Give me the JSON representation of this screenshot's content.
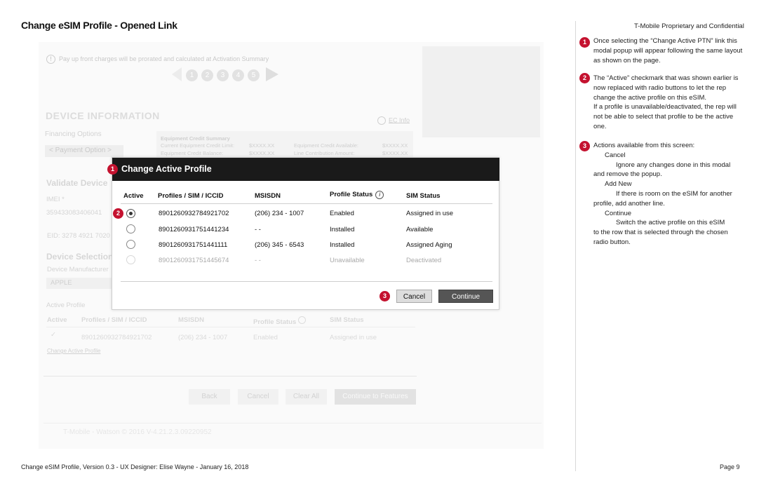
{
  "page_title": "Change eSIM Profile - Opened Link",
  "confidential": "T-Mobile Proprietary and Confidential",
  "footer": {
    "left": "Change eSIM Profile, Version 0.3 - UX Designer: Elise Wayne - January 16, 2018",
    "right": "Page 9"
  },
  "background_app": {
    "notice": "Pay up front charges will be prorated and calculated at Activation Summary",
    "notice_icon": "exclamation-icon",
    "steps": [
      "1",
      "2",
      "3",
      "4",
      "5"
    ],
    "device_info_title": "DEVICE INFORMATION",
    "ec_info": "EC Info",
    "financing_options": "Financing Options",
    "payment_option": "< Payment Option >",
    "ec_summary": {
      "title": "Equipment Credit Summary",
      "current_limit_label": "Current Equipment Credit Limit:",
      "current_limit_value": "$XXXX.XX",
      "available_label": "Equipment Credit Available:",
      "available_value": "$XXXX.XX",
      "balance_label": "Equipment Credit Balance:",
      "balance_value": "$XXXX.XX",
      "line_contribution_label": "Line Contribution Amount:",
      "line_contribution_value": "$XXXX.XX"
    },
    "validate_device": "Validate Device",
    "imei_label": "IMEI *",
    "imei_value": "359433083406041",
    "eid": "EID: 3278 4921 7020",
    "device_selection": "Device Selection",
    "device_manufacturer": "Device Manufacturer",
    "manufacturer_value": "APPLE",
    "active_profile": "Active Profile",
    "table_headers": [
      "Active",
      "Profiles / SIM / ICCID",
      "MSISDN",
      "Profile Status",
      "SIM Status"
    ],
    "table_row": {
      "iccid": "8901260932784921702",
      "msisdn": "(206) 234 - 1007",
      "profile_status": "Enabled",
      "sim_status": "Assigned in use"
    },
    "change_link": "Change Active Profile",
    "buttons": {
      "back": "Back",
      "cancel": "Cancel",
      "clear_all": "Clear All",
      "continue": "Continue to Features"
    },
    "footer": "T-Mobile - Watson © 2016 V-4.21.2.3.09220952"
  },
  "modal": {
    "title": "Change Active Profile",
    "headers": {
      "active": "Active",
      "profiles": "Profiles / SIM / ICCID",
      "msisdn": "MSISDN",
      "profile_status": "Profile Status",
      "sim_status": "SIM Status"
    },
    "rows": [
      {
        "iccid": "8901260932784921702",
        "msisdn": "(206) 234 - 1007",
        "profile_status": "Enabled",
        "sim_status": "Assigned in use",
        "selected": true,
        "disabled": false
      },
      {
        "iccid": "8901260931751441234",
        "msisdn": "- -",
        "profile_status": "Installed",
        "sim_status": "Available",
        "selected": false,
        "disabled": false
      },
      {
        "iccid": "8901260931751441111",
        "msisdn": "(206) 345 - 6543",
        "profile_status": "Installed",
        "sim_status": "Assigned Aging",
        "selected": false,
        "disabled": false
      },
      {
        "iccid": "8901260931751445674",
        "msisdn": "- -",
        "profile_status": "Unavailable",
        "sim_status": "Deactivated",
        "selected": false,
        "disabled": true
      }
    ],
    "cancel_label": "Cancel",
    "continue_label": "Continue"
  },
  "callouts": [
    "1",
    "2",
    "3"
  ],
  "notes": {
    "note1": "Once selecting the “Change Active PTN” link this modal popup will appear following the same layout as shown on the page.",
    "note2_a": "The “Active” checkmark that was shown earlier is now replaced with radio buttons to let the rep change the active profile on this eSIM.",
    "note2_b": "If a profile is unavailable/deactivated, the rep will not be able to select that profile to be the active one.",
    "note3_intro": "Actions available from this screen:",
    "note3_cancel": "Cancel",
    "note3_cancel_desc_1": "Ignore any changes done in this modal",
    "note3_cancel_desc_2": "and remove the popup.",
    "note3_addnew": "Add New",
    "note3_addnew_desc_1": "If there is room on the eSIM for another",
    "note3_addnew_desc_2": "profile, add another line.",
    "note3_continue": "Continue",
    "note3_continue_desc_1": "Switch the active profile on this eSIM",
    "note3_continue_desc_2": "to the row that is selected through the chosen radio button."
  },
  "colors": {
    "callout": "#c4122f",
    "modal_header": "#1a1a1a"
  }
}
